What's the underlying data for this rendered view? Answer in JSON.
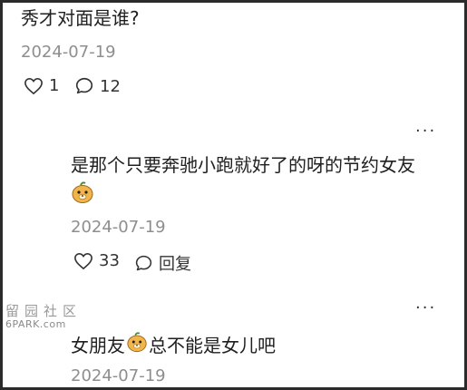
{
  "post": {
    "question": "秀才对面是谁?",
    "date": "2024-07-19",
    "likes": "1",
    "comments": "12"
  },
  "replies": [
    {
      "text": "是那个只要奔驰小跑就好了的呀的节约女友",
      "date": "2024-07-19",
      "likes": "33",
      "reply_label": "回复",
      "more": "···"
    },
    {
      "text_before": "女朋友",
      "text_after": "总不能是女儿吧",
      "date": "2024-07-19",
      "more": "···"
    }
  ],
  "watermark": {
    "line1": "留园社区",
    "line2": "6PARK.com"
  },
  "icons": [
    "heart-icon",
    "comment-icon",
    "emoji-face-icon",
    "more-icon"
  ]
}
